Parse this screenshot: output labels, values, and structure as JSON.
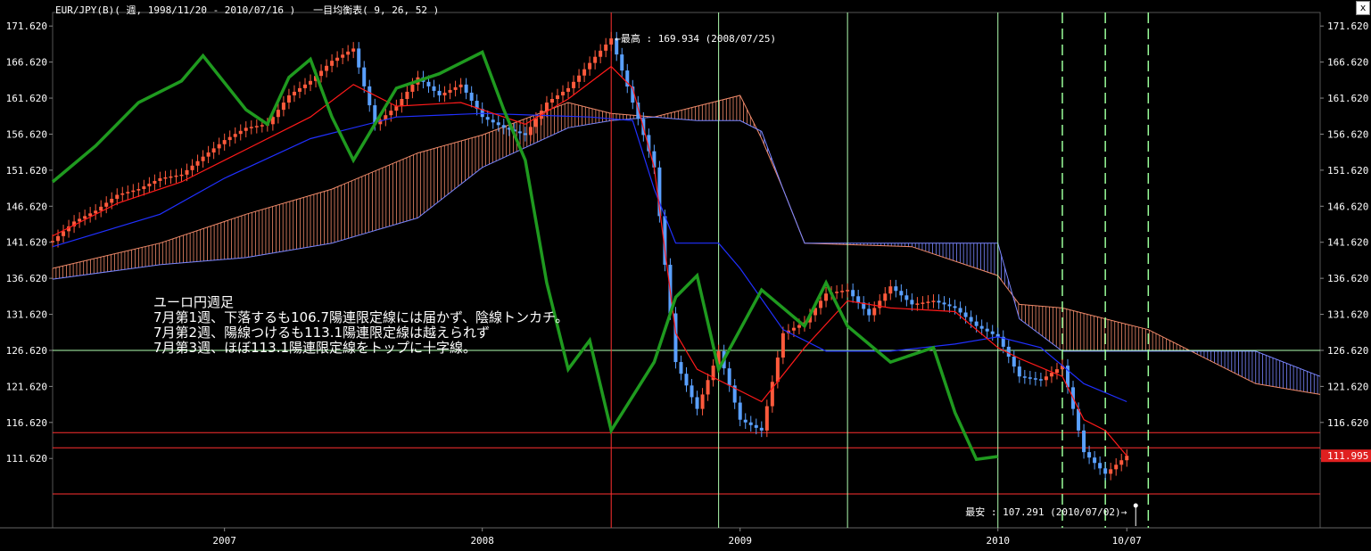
{
  "header": {
    "title": "EUR/JPY(B)( 週, 1998/11/20 - 2010/07/16 )",
    "indicator": "一目均衡表( 9, 26, 52 )"
  },
  "window": {
    "close_glyph": "x"
  },
  "note_lines": [
    "ユーロ円週足",
    "7月第1週、下落するも106.7陽連限定線には届かず、陰線トンカチ。",
    "7月第2週、陽線つけるも113.1陽連限定線は越えられず",
    "7月第3週、ほぼ113.1陽連限定線をトップに十字線。"
  ],
  "annotations": {
    "high_label": "最高 : 169.934 (2008/07/25)",
    "low_label": "最安 : 107.291 (2010/07/02)",
    "current_price": "111.995"
  },
  "colors": {
    "background": "#000000",
    "bull_candle": "#ff5a3c",
    "bear_candle": "#5aa0ff",
    "tenkan": "#ff1a1a",
    "kijun": "#2030ff",
    "chikou": "#1f9a1f",
    "cloud_bull": "#f08a6a",
    "cloud_bear": "#7a86ff",
    "hline": "#ff3030",
    "support_line": "#b0ffb0",
    "vline_major": "#b0ffb0",
    "vline_dashed": "#9aff9a",
    "axis_text": "#ffffff",
    "price_badge": "#e02020"
  },
  "chart_data": {
    "type": "candlestick",
    "title": "EUR/JPY(B)( 週, 1998/11/20 - 2010/07/16 )",
    "indicator": "一目均衡表( 9, 26, 52 )",
    "y_ticks": [
      171.62,
      166.62,
      161.62,
      156.62,
      151.62,
      146.62,
      141.62,
      136.62,
      131.62,
      126.62,
      121.62,
      116.62,
      111.62
    ],
    "y_tick_labels": [
      "171.620",
      "166.620",
      "161.620",
      "156.620",
      "151.620",
      "146.620",
      "141.620",
      "136.620",
      "131.620",
      "126.620",
      "121.620",
      "116.620",
      "111.620"
    ],
    "ylim": [
      102.0,
      173.5
    ],
    "x_labels": [
      "2007",
      "2008",
      "2009",
      "2010",
      "10/07"
    ],
    "x_label_dates": [
      "2007-01",
      "2008-01",
      "2009-01",
      "2010-01",
      "2010-07"
    ],
    "xlim": [
      "2006-05",
      "2011-04"
    ],
    "highest": {
      "value": 169.934,
      "date": "2008-07-25"
    },
    "lowest": {
      "value": 107.291,
      "date": "2010-07-02"
    },
    "last_close": 111.995,
    "horizontal_lines": [
      115.2,
      113.1,
      106.7,
      126.62
    ],
    "vertical_lines_solid": [
      "2008-07",
      "2008-12",
      "2009-06",
      "2010-01"
    ],
    "vertical_lines_dashed": [
      "2010-04",
      "2010-06",
      "2010-08"
    ],
    "series": [
      {
        "name": "close",
        "points": [
          [
            "2006-05",
            141.8
          ],
          [
            "2006-06",
            144.5
          ],
          [
            "2006-07",
            146.0
          ],
          [
            "2006-08",
            148.2
          ],
          [
            "2006-09",
            149.0
          ],
          [
            "2006-10",
            150.5
          ],
          [
            "2006-11",
            151.0
          ],
          [
            "2006-12",
            153.5
          ],
          [
            "2007-01",
            155.8
          ],
          [
            "2007-02",
            157.5
          ],
          [
            "2007-03",
            158.0
          ],
          [
            "2007-04",
            162.0
          ],
          [
            "2007-05",
            164.0
          ],
          [
            "2007-06",
            166.8
          ],
          [
            "2007-07",
            168.5
          ],
          [
            "2007-08",
            158.0
          ],
          [
            "2007-09",
            160.5
          ],
          [
            "2007-10",
            164.5
          ],
          [
            "2007-11",
            162.0
          ],
          [
            "2007-12",
            163.5
          ],
          [
            "2008-01",
            159.0
          ],
          [
            "2008-02",
            157.5
          ],
          [
            "2008-03",
            156.5
          ],
          [
            "2008-04",
            161.0
          ],
          [
            "2008-05",
            163.0
          ],
          [
            "2008-06",
            166.5
          ],
          [
            "2008-07",
            169.9
          ],
          [
            "2008-08",
            161.0
          ],
          [
            "2008-09",
            152.0
          ],
          [
            "2008-10",
            125.0
          ],
          [
            "2008-11",
            118.5
          ],
          [
            "2008-12",
            126.5
          ],
          [
            "2009-01",
            117.0
          ],
          [
            "2009-02",
            115.5
          ],
          [
            "2009-03",
            129.0
          ],
          [
            "2009-04",
            130.5
          ],
          [
            "2009-05",
            134.5
          ],
          [
            "2009-06",
            135.0
          ],
          [
            "2009-07",
            131.5
          ],
          [
            "2009-08",
            135.5
          ],
          [
            "2009-09",
            133.0
          ],
          [
            "2009-10",
            133.5
          ],
          [
            "2009-11",
            132.5
          ],
          [
            "2009-12",
            130.0
          ],
          [
            "2010-01",
            128.5
          ],
          [
            "2010-02",
            123.0
          ],
          [
            "2010-03",
            122.5
          ],
          [
            "2010-04",
            124.5
          ],
          [
            "2010-05",
            112.5
          ],
          [
            "2010-06",
            109.5
          ],
          [
            "2010-07",
            112.0
          ]
        ]
      },
      {
        "name": "tenkan",
        "points": [
          [
            "2006-05",
            142.5
          ],
          [
            "2006-08",
            147.0
          ],
          [
            "2006-11",
            150.0
          ],
          [
            "2007-02",
            154.5
          ],
          [
            "2007-05",
            159.0
          ],
          [
            "2007-07",
            163.5
          ],
          [
            "2007-09",
            160.5
          ],
          [
            "2007-12",
            161.0
          ],
          [
            "2008-03",
            158.0
          ],
          [
            "2008-05",
            161.5
          ],
          [
            "2008-07",
            166.0
          ],
          [
            "2008-08",
            163.0
          ],
          [
            "2008-09",
            152.0
          ],
          [
            "2008-10",
            129.0
          ],
          [
            "2008-11",
            124.0
          ],
          [
            "2009-01",
            121.0
          ],
          [
            "2009-02",
            119.5
          ],
          [
            "2009-04",
            127.0
          ],
          [
            "2009-06",
            133.5
          ],
          [
            "2009-08",
            132.5
          ],
          [
            "2009-11",
            132.0
          ],
          [
            "2010-01",
            127.0
          ],
          [
            "2010-02",
            125.5
          ],
          [
            "2010-04",
            123.0
          ],
          [
            "2010-05",
            117.0
          ],
          [
            "2010-06",
            115.5
          ],
          [
            "2010-07",
            112.0
          ]
        ]
      },
      {
        "name": "kijun",
        "points": [
          [
            "2006-05",
            141.0
          ],
          [
            "2006-10",
            145.5
          ],
          [
            "2007-01",
            150.5
          ],
          [
            "2007-05",
            156.0
          ],
          [
            "2007-09",
            159.0
          ],
          [
            "2008-01",
            159.5
          ],
          [
            "2008-06",
            159.0
          ],
          [
            "2008-08",
            158.5
          ],
          [
            "2008-09",
            149.0
          ],
          [
            "2008-10",
            141.5
          ],
          [
            "2008-12",
            141.5
          ],
          [
            "2009-01",
            138.0
          ],
          [
            "2009-03",
            129.5
          ],
          [
            "2009-05",
            126.5
          ],
          [
            "2009-08",
            126.5
          ],
          [
            "2009-11",
            127.5
          ],
          [
            "2010-01",
            128.5
          ],
          [
            "2010-03",
            127.0
          ],
          [
            "2010-05",
            122.0
          ],
          [
            "2010-07",
            119.5
          ]
        ]
      },
      {
        "name": "chikou",
        "points": [
          [
            "2006-05",
            150.0
          ],
          [
            "2006-07",
            155.0
          ],
          [
            "2006-09",
            161.0
          ],
          [
            "2006-11",
            164.0
          ],
          [
            "2006-12",
            167.5
          ],
          [
            "2007-02",
            160.0
          ],
          [
            "2007-03",
            158.0
          ],
          [
            "2007-04",
            164.5
          ],
          [
            "2007-05",
            167.0
          ],
          [
            "2007-06",
            159.0
          ],
          [
            "2007-07",
            153.0
          ],
          [
            "2007-09",
            163.0
          ],
          [
            "2007-11",
            165.0
          ],
          [
            "2008-01",
            168.0
          ],
          [
            "2008-02",
            160.0
          ],
          [
            "2008-03",
            153.0
          ],
          [
            "2008-04",
            136.0
          ],
          [
            "2008-05",
            124.0
          ],
          [
            "2008-06",
            128.0
          ],
          [
            "2008-07",
            115.5
          ],
          [
            "2008-09",
            125.0
          ],
          [
            "2008-10",
            134.0
          ],
          [
            "2008-11",
            137.0
          ],
          [
            "2008-12",
            124.0
          ],
          [
            "2009-02",
            135.0
          ],
          [
            "2009-04",
            130.0
          ],
          [
            "2009-05",
            136.0
          ],
          [
            "2009-06",
            130.0
          ],
          [
            "2009-08",
            125.0
          ],
          [
            "2009-10",
            127.0
          ],
          [
            "2009-11",
            118.0
          ],
          [
            "2009-12",
            111.5
          ],
          [
            "2010-01",
            111.9
          ]
        ]
      },
      {
        "name": "senkou_a",
        "points": [
          [
            "2006-05",
            138.0
          ],
          [
            "2006-10",
            141.5
          ],
          [
            "2007-02",
            145.5
          ],
          [
            "2007-06",
            149.0
          ],
          [
            "2007-10",
            154.0
          ],
          [
            "2008-01",
            156.5
          ],
          [
            "2008-05",
            161.0
          ],
          [
            "2008-07",
            159.5
          ],
          [
            "2008-09",
            159.0
          ],
          [
            "2008-11",
            160.5
          ],
          [
            "2009-01",
            162.0
          ],
          [
            "2009-02",
            156.0
          ],
          [
            "2009-03",
            149.0
          ],
          [
            "2009-04",
            141.5
          ],
          [
            "2009-09",
            141.0
          ],
          [
            "2010-01",
            137.0
          ],
          [
            "2010-02",
            133.0
          ],
          [
            "2010-04",
            132.5
          ],
          [
            "2010-06",
            131.0
          ],
          [
            "2010-08",
            129.5
          ],
          [
            "2010-11",
            125.0
          ],
          [
            "2011-01",
            122.0
          ],
          [
            "2011-04",
            120.5
          ]
        ]
      },
      {
        "name": "senkou_b",
        "points": [
          [
            "2006-05",
            136.5
          ],
          [
            "2006-10",
            138.5
          ],
          [
            "2007-02",
            139.5
          ],
          [
            "2007-06",
            141.5
          ],
          [
            "2007-10",
            145.0
          ],
          [
            "2008-01",
            152.0
          ],
          [
            "2008-05",
            157.5
          ],
          [
            "2008-07",
            158.5
          ],
          [
            "2008-09",
            159.0
          ],
          [
            "2008-11",
            158.5
          ],
          [
            "2009-01",
            158.5
          ],
          [
            "2009-02",
            157.0
          ],
          [
            "2009-03",
            149.0
          ],
          [
            "2009-04",
            141.5
          ],
          [
            "2009-09",
            141.5
          ],
          [
            "2010-01",
            141.5
          ],
          [
            "2010-02",
            131.0
          ],
          [
            "2010-04",
            126.5
          ],
          [
            "2010-06",
            126.5
          ],
          [
            "2010-08",
            126.5
          ],
          [
            "2010-11",
            126.5
          ],
          [
            "2011-01",
            126.5
          ],
          [
            "2011-04",
            123.0
          ]
        ]
      }
    ]
  }
}
